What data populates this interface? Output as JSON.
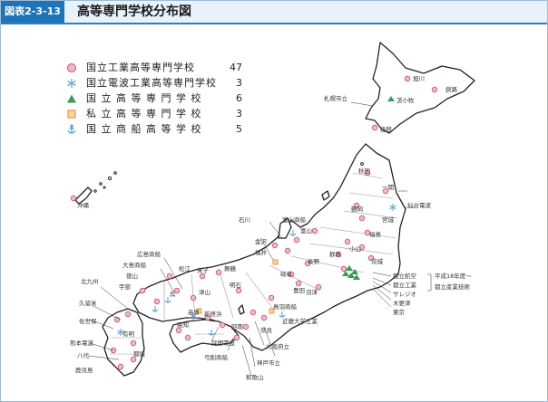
{
  "figure": {
    "number": "図表2-3-13",
    "title": "高等専門学校分布図"
  },
  "colors": {
    "header_bg": "#1f74b8",
    "national_tech": "#f1b8c6",
    "radio_tech": "#6fa7d6",
    "national": "#3a9b56",
    "private": "#e89a3c",
    "merchant_marine": "#3d8fcf"
  },
  "legend": [
    {
      "symbol": "circle-pink-icon",
      "label": "国立工業高等専門学校",
      "count": "47"
    },
    {
      "symbol": "asterisk-icon",
      "label": "国立電波工業高等専門学校",
      "count": "3"
    },
    {
      "symbol": "triangle-green-icon",
      "label": "国 立 高 等 専 門 学 校",
      "count": "6"
    },
    {
      "symbol": "square-orange-icon",
      "label": "私 立 高 等 専 門 学 校",
      "count": "3"
    },
    {
      "symbol": "anchor-icon",
      "label": "国 立 商 船 高 等 学 校",
      "count": "5"
    }
  ],
  "places": [
    "旭川",
    "釧路",
    "札幌市立",
    "苫小牧",
    "函館",
    "沖縄",
    "秋田",
    "一関",
    "仙台電波",
    "鶴岡",
    "宮城",
    "福島",
    "石川",
    "富山商船",
    "富山",
    "金沢",
    "福井",
    "長野",
    "群馬",
    "小山",
    "茨城",
    "岐阜",
    "豊田",
    "沼津",
    "鳥羽商船",
    "近畿大学工業",
    "奈良",
    "大阪府立",
    "神戸市立",
    "和歌山",
    "明石",
    "舞鶴",
    "米子",
    "松江",
    "広島商船",
    "大島商船",
    "徳山",
    "宇部",
    "北九州",
    "久留米",
    "佐世保",
    "熊本電波",
    "八代",
    "鹿児島",
    "都城",
    "有明",
    "呉",
    "津山",
    "高専",
    "阿南",
    "詫間電波",
    "弓削商船",
    "高知",
    "新居浜",
    "都立航空",
    "都立工業",
    "サレジオ",
    "木更津",
    "東京",
    "平成18年度～",
    "都立産業技術"
  ]
}
